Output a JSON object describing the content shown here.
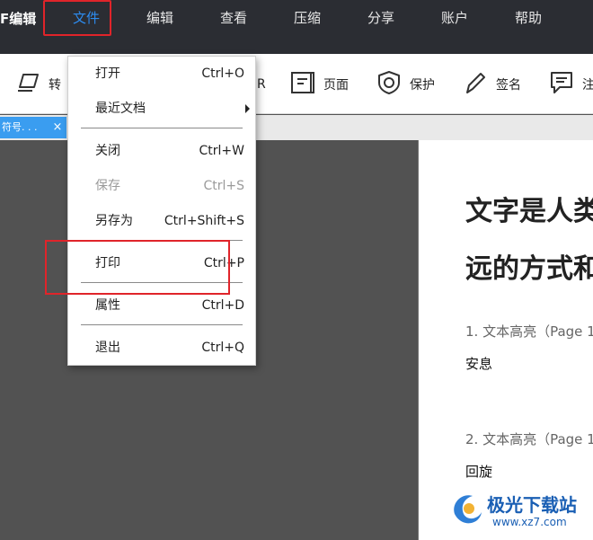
{
  "app": {
    "title": "F编辑"
  },
  "menubar": {
    "items": [
      {
        "label": "文件"
      },
      {
        "label": "编辑"
      },
      {
        "label": "查看"
      },
      {
        "label": "压缩"
      },
      {
        "label": "分享"
      },
      {
        "label": "账户"
      },
      {
        "label": "帮助"
      }
    ],
    "active_color": "#2d8cf0"
  },
  "toolbar": {
    "convert_label": "转",
    "ocr_label": "R",
    "page_label": "页面",
    "protect_label": "保护",
    "sign_label": "签名",
    "comment_label": "注"
  },
  "tabbar": {
    "doc_tab_label": "符号. . .",
    "close_glyph": "×"
  },
  "file_menu": {
    "items": [
      {
        "label": "打开",
        "shortcut": "Ctrl+O",
        "enabled": true
      },
      {
        "label": "最近文档",
        "shortcut": "",
        "enabled": true,
        "submenu": true
      },
      {
        "label": "关闭",
        "shortcut": "Ctrl+W",
        "enabled": true
      },
      {
        "label": "保存",
        "shortcut": "Ctrl+S",
        "enabled": false
      },
      {
        "label": "另存为",
        "shortcut": "Ctrl+Shift+S",
        "enabled": true
      },
      {
        "label": "打印",
        "shortcut": "Ctrl+P",
        "enabled": true
      },
      {
        "label": "属性",
        "shortcut": "Ctrl+D",
        "enabled": true
      },
      {
        "label": "退出",
        "shortcut": "Ctrl+Q",
        "enabled": true
      }
    ]
  },
  "document": {
    "heading_line1": "文字是人类",
    "heading_line2": "远的方式和",
    "notes": [
      {
        "title": "1. 文本高亮（Page 1",
        "body": "安息"
      },
      {
        "title": "2. 文本高亮（Page 1",
        "body": "回旋"
      }
    ]
  },
  "watermark": {
    "text1": "极光下载站",
    "text2": "www.xz7.com"
  },
  "colors": {
    "menubar_bg": "#2b2d33",
    "highlight_red": "#e0242a",
    "tab_blue": "#3a9df0",
    "workspace_bg": "#525252"
  }
}
